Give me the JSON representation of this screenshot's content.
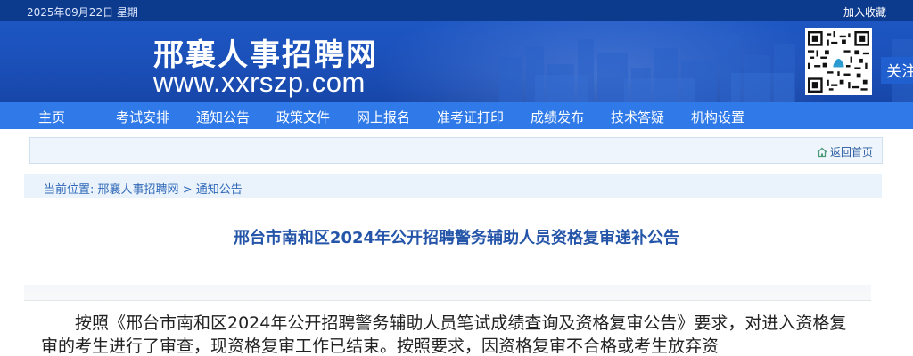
{
  "topbar": {
    "date": "2025年09月22日 星期一",
    "favorite": "加入收藏"
  },
  "header": {
    "site_name": "邢襄人事招聘网",
    "site_url": "www.xxrszp.com",
    "follow_label": "关注"
  },
  "nav": {
    "items": [
      {
        "label": "主页"
      },
      {
        "label": "考试安排"
      },
      {
        "label": "通知公告"
      },
      {
        "label": "政策文件"
      },
      {
        "label": "网上报名"
      },
      {
        "label": "准考证打印"
      },
      {
        "label": "成绩发布"
      },
      {
        "label": "技术答疑"
      },
      {
        "label": "机构设置"
      }
    ]
  },
  "return_home": {
    "label": "返回首页",
    "icon": "home-icon"
  },
  "breadcrumb": {
    "prefix": "当前位置:",
    "site": "邢襄人事招聘网",
    "separator": ">",
    "current": "通知公告"
  },
  "article": {
    "title": "邢台市南和区2024年公开招聘警务辅助人员资格复审递补公告",
    "body": "按照《邢台市南和区2024年公开招聘警务辅助人员笔试成绩查询及资格复审公告》要求，对进入资格复审的考生进行了审查，现资格复审工作已结束。按照要求，因资格复审不合格或考生放弃资"
  },
  "colors": {
    "topbar": "#0c3a8c",
    "banner": "#1d56c2",
    "nav": "#2f7ae8",
    "title": "#2455a8"
  }
}
